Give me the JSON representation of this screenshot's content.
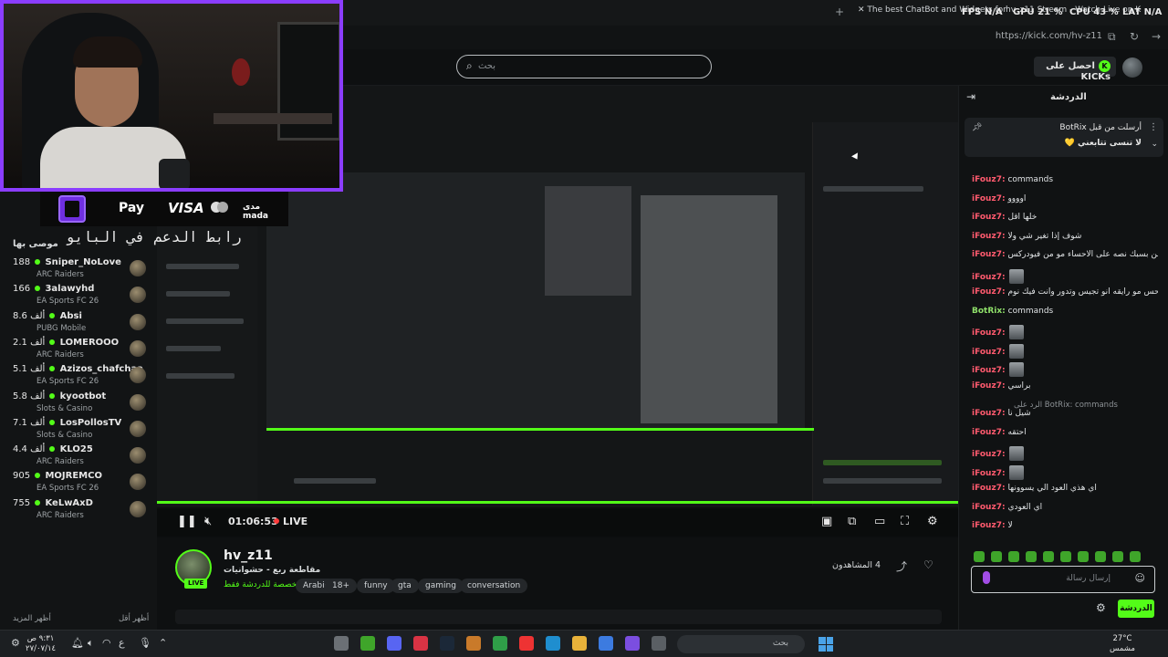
{
  "browser": {
    "tabs": [
      "The best ChatBot and Widgets for",
      "hv_z11 Stream - Watch Live on K"
    ],
    "url": "https://kick.com/hv-z11",
    "hud": {
      "fps": "FPS N/A",
      "gpu": "GPU 21 %",
      "cpu": "CPU 43 %",
      "lat": "LAT N/A"
    }
  },
  "header": {
    "search_placeholder": "بحث",
    "kicks_label": "احصل على KICKs"
  },
  "overlay": {
    "pay_labels": [
      "Pay",
      "VISA",
      "مدى mada"
    ],
    "support_text": "رابط الدعم في البايو"
  },
  "sidebar": {
    "title": "موصى بها",
    "items": [
      {
        "count": "188",
        "name": "Sniper_NoLove",
        "game": "ARC Raiders"
      },
      {
        "count": "166",
        "name": "3alawyhd",
        "game": "EA Sports FC 26"
      },
      {
        "count": "8.6 ألف",
        "name": "Absi",
        "game": "PUBG Mobile"
      },
      {
        "count": "2.1 ألف",
        "name": "LOMEROOO",
        "game": "ARC Raiders"
      },
      {
        "count": "5.1 ألف",
        "name": "Azizos_chafchaa",
        "game": "EA Sports FC 26"
      },
      {
        "count": "5.8 ألف",
        "name": "kyootbot",
        "game": "Slots & Casino"
      },
      {
        "count": "7.1 ألف",
        "name": "LosPollosTV",
        "game": "Slots & Casino"
      },
      {
        "count": "4.4 ألف",
        "name": "KLO25",
        "game": "ARC Raiders"
      },
      {
        "count": "905",
        "name": "MOJREMCO",
        "game": "EA Sports FC 26"
      },
      {
        "count": "755",
        "name": "KeLwAxD",
        "game": "ARC Raiders"
      }
    ],
    "show_more": "أظهر المزيد",
    "show_less": "أظهر أقل"
  },
  "player": {
    "time": "01:06:53",
    "live": "LIVE",
    "progress": 1.0
  },
  "stream": {
    "name": "hv_z11",
    "title": "مقاطعة ربع - حشوانيات",
    "category": "مخصصة للدردشة فقط",
    "tags": [
      "Arabic",
      "18+",
      "funny",
      "gta",
      "gaming",
      "conversation"
    ],
    "viewers": "4 المشاهدون",
    "live_badge": "LIVE"
  },
  "chat": {
    "title": "الدردشة",
    "pinned": {
      "meta": "أرسلت من قبل BotRix",
      "text": "لا تنسى تتابعني 💛"
    },
    "messages": [
      {
        "user": "iFouz7:",
        "text": "commands",
        "thumb": false,
        "bot": false
      },
      {
        "user": "iFouz7:",
        "text": "اوووو",
        "thumb": false,
        "bot": false
      },
      {
        "user": "iFouz7:",
        "text": "خلها اقل",
        "thumb": false,
        "bot": false
      },
      {
        "user": "iFouz7:",
        "text": "شوف إذا تغير شي ولا",
        "thumb": false,
        "bot": false
      },
      {
        "user": "iFouz7:",
        "text": "من بسبك نصه على الاحساء مو من فيودركس",
        "thumb": false,
        "bot": false
      },
      {
        "user": "iFouz7:",
        "text": "",
        "thumb": true,
        "bot": false
      },
      {
        "user": "iFouz7:",
        "text": "احس مو رايقه انو تجيس وتدور وأنت فيك نوم",
        "thumb": false,
        "bot": false
      },
      {
        "user": "BotRix:",
        "text": "commands",
        "thumb": false,
        "bot": true
      },
      {
        "user": "iFouz7:",
        "text": "",
        "thumb": true,
        "bot": false
      },
      {
        "user": "iFouz7:",
        "text": "",
        "thumb": true,
        "bot": false
      },
      {
        "user": "iFouz7:",
        "text": "",
        "thumb": true,
        "bot": false
      },
      {
        "user": "iFouz7:",
        "text": "براسي",
        "thumb": false,
        "bot": false
      },
      {
        "user": "iFouz7:",
        "text": "شيل نا",
        "thumb": false,
        "bot": false
      },
      {
        "user": "iFouz7:",
        "text": "احتقه",
        "thumb": false,
        "bot": false
      },
      {
        "user": "iFouz7:",
        "text": "",
        "thumb": true,
        "bot": false
      },
      {
        "user": "iFouz7:",
        "text": "",
        "thumb": true,
        "bot": false
      },
      {
        "user": "iFouz7:",
        "text": "اي هذي العود الي يسوونها",
        "thumb": false,
        "bot": false
      },
      {
        "user": "iFouz7:",
        "text": "اي العودي",
        "thumb": false,
        "bot": false
      },
      {
        "user": "iFouz7:",
        "text": "لا",
        "thumb": false,
        "bot": false
      }
    ],
    "reply_note": "الرد على BotRix: commands",
    "input_placeholder": "إرسال رسالة",
    "send_label": "الدردشة"
  },
  "taskbar": {
    "time": "٩:٣١ ص",
    "date": "٢٧/٠٧/١٤",
    "search_placeholder": "بحث",
    "temp": "27°C",
    "weather": "مشمس"
  },
  "colors": {
    "accent": "#53fc18",
    "frame": "#8b3dff",
    "chat_user": "#ff5a6e"
  }
}
